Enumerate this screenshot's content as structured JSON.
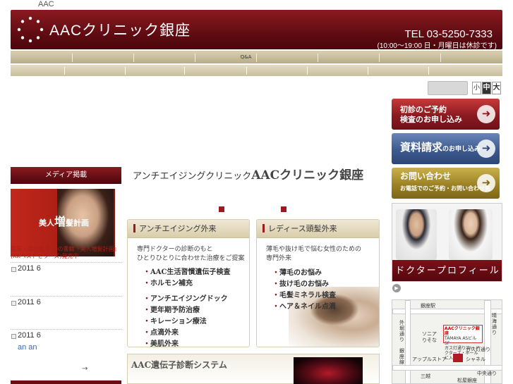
{
  "top": {
    "brand_small": "AAC"
  },
  "header": {
    "logo_text": "AACクリニック銀座",
    "tel": "TEL 03-5250-7333",
    "hours": "(10:00〜19:00 日・月曜日は休診です)"
  },
  "nav": {
    "qa_label": "Q&A"
  },
  "font_size": {
    "small": "小",
    "medium": "中",
    "large": "大"
  },
  "sidebar": {
    "media_heading": "メディア掲載",
    "book": {
      "title_pre": "美人",
      "title_big": "増",
      "title_post": "髪計画",
      "caption": "院長・浜中聡子 著の書籍『美人増髪計画』(KKベストセラーズ)発売中"
    },
    "news": [
      {
        "date": "2011 6"
      },
      {
        "date": "2011 6"
      },
      {
        "date": "2011 6"
      }
    ],
    "news_link": "an an",
    "more": "→"
  },
  "main": {
    "tagline": "アンチエイジングクリニック",
    "brand": "AACクリニック銀座",
    "box_anti": {
      "heading": "アンチエイジング外来",
      "desc_1": "専門ドクターの診断のもと",
      "desc_2": "ひとりひとりに合わせた治療をご提案",
      "items_a": [
        "AAC生活習慣遺伝子検査",
        "ホルモン補充"
      ],
      "items_b": [
        "アンチエイジングドック",
        "更年期予防治療",
        "キレーション療法",
        "点滴外来",
        "美肌外来"
      ]
    },
    "box_ladies": {
      "heading": "レディース頭髪外来",
      "desc_1": "薄毛や抜け毛で悩む女性のための",
      "desc_2": "専門外来",
      "items": [
        "薄毛のお悩み",
        "抜け毛のお悩み",
        "毛髪ミネラル検査",
        "ヘア＆ネイル点滴"
      ]
    },
    "gene_title": "AAC遺伝子診断システム"
  },
  "right": {
    "reserve_1": "初診のご予約",
    "reserve_2": "検査のお申し込み",
    "docs_1": "資料請求",
    "docs_2": "のお申し込み",
    "contact_1": "お問い合わせ",
    "contact_2": "お電話でのご予約・お問い合わせ先",
    "doctor_profile": "ドクタープロフィール",
    "map": {
      "station": "銀座駅",
      "clinic_name": "AACクリニック銀座",
      "building": "TAMAYA ASビル5F",
      "note": "ガス灯通り沿い ドクターズ・ホールに入口",
      "gas_street": "ガス灯通り",
      "sony": "ソニア",
      "bank": "りそな",
      "apple": "アップルストア",
      "chanel": "シャネル",
      "chuo": "中央通り",
      "mitsukoshi": "三越",
      "matsuya": "松屋銀座",
      "sotobori": "外堀通り",
      "ginza_line": "銀座線",
      "harumi": "晴海通り"
    }
  }
}
